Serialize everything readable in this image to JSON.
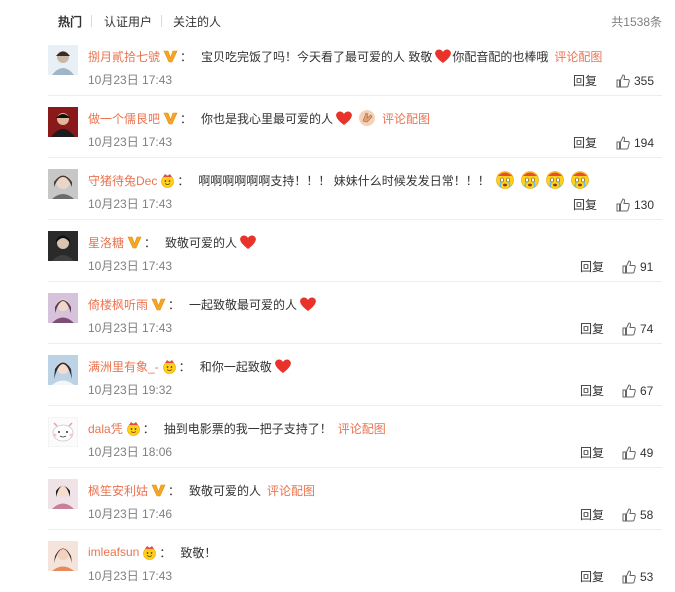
{
  "tabs": {
    "hot": "热门",
    "verified": "认证用户",
    "following": "关注的人",
    "total": "共1538条"
  },
  "common": {
    "reply": "回复",
    "pic_link": "评论配图",
    "colon": "："
  },
  "comments": [
    {
      "user": "捌月貳拾七號",
      "badge": "v-gold",
      "text": "宝贝吃完饭了吗！今天看了最可爱的人 致敬",
      "suffix": "你配音配的也棒哦",
      "time": "10月23日 17:43",
      "likes": "355",
      "has_pic": true
    },
    {
      "user": "做一个儒艮吧",
      "badge": "v-gold",
      "text": "你也是我心里最可爱的人",
      "suffix": "",
      "time": "10月23日 17:43",
      "likes": "194",
      "has_pic": true
    },
    {
      "user": "守猪待兔Dec",
      "badge": "crown",
      "text": "啊啊啊啊啊啊支持！！！ 妹妹什么时候发发日常！！！",
      "suffix": "",
      "time": "10月23日 17:43",
      "likes": "130",
      "has_pic": false
    },
    {
      "user": "星洛糖",
      "badge": "v-gold",
      "text": "致敬可爱的人",
      "suffix": "",
      "time": "10月23日 17:43",
      "likes": "91",
      "has_pic": false
    },
    {
      "user": "倚楼枫听雨",
      "badge": "v-gold",
      "text": "一起致敬最可爱的人",
      "suffix": "",
      "time": "10月23日 17:43",
      "likes": "74",
      "has_pic": false
    },
    {
      "user": "满洲里有象_-",
      "badge": "crown",
      "text": "和你一起致敬",
      "suffix": "",
      "time": "10月23日 19:32",
      "likes": "67",
      "has_pic": false
    },
    {
      "user": "dala凭",
      "badge": "crown",
      "text": "抽到电影票的我一把子支持了！",
      "suffix": "",
      "time": "10月23日 18:06",
      "likes": "49",
      "has_pic": true
    },
    {
      "user": "枫笙安利姑",
      "badge": "v-gold",
      "text": "致敬可爱的人",
      "suffix": "",
      "time": "10月23日 17:46",
      "likes": "58",
      "has_pic": true
    },
    {
      "user": "imleafsun",
      "badge": "crown",
      "text": "致敬！",
      "suffix": "",
      "time": "10月23日 17:43",
      "likes": "53",
      "has_pic": false
    }
  ],
  "colors": {
    "username": "#eb7350",
    "heart": "#e8322a",
    "v_badge": "#f5a623",
    "muted": "#808080"
  }
}
